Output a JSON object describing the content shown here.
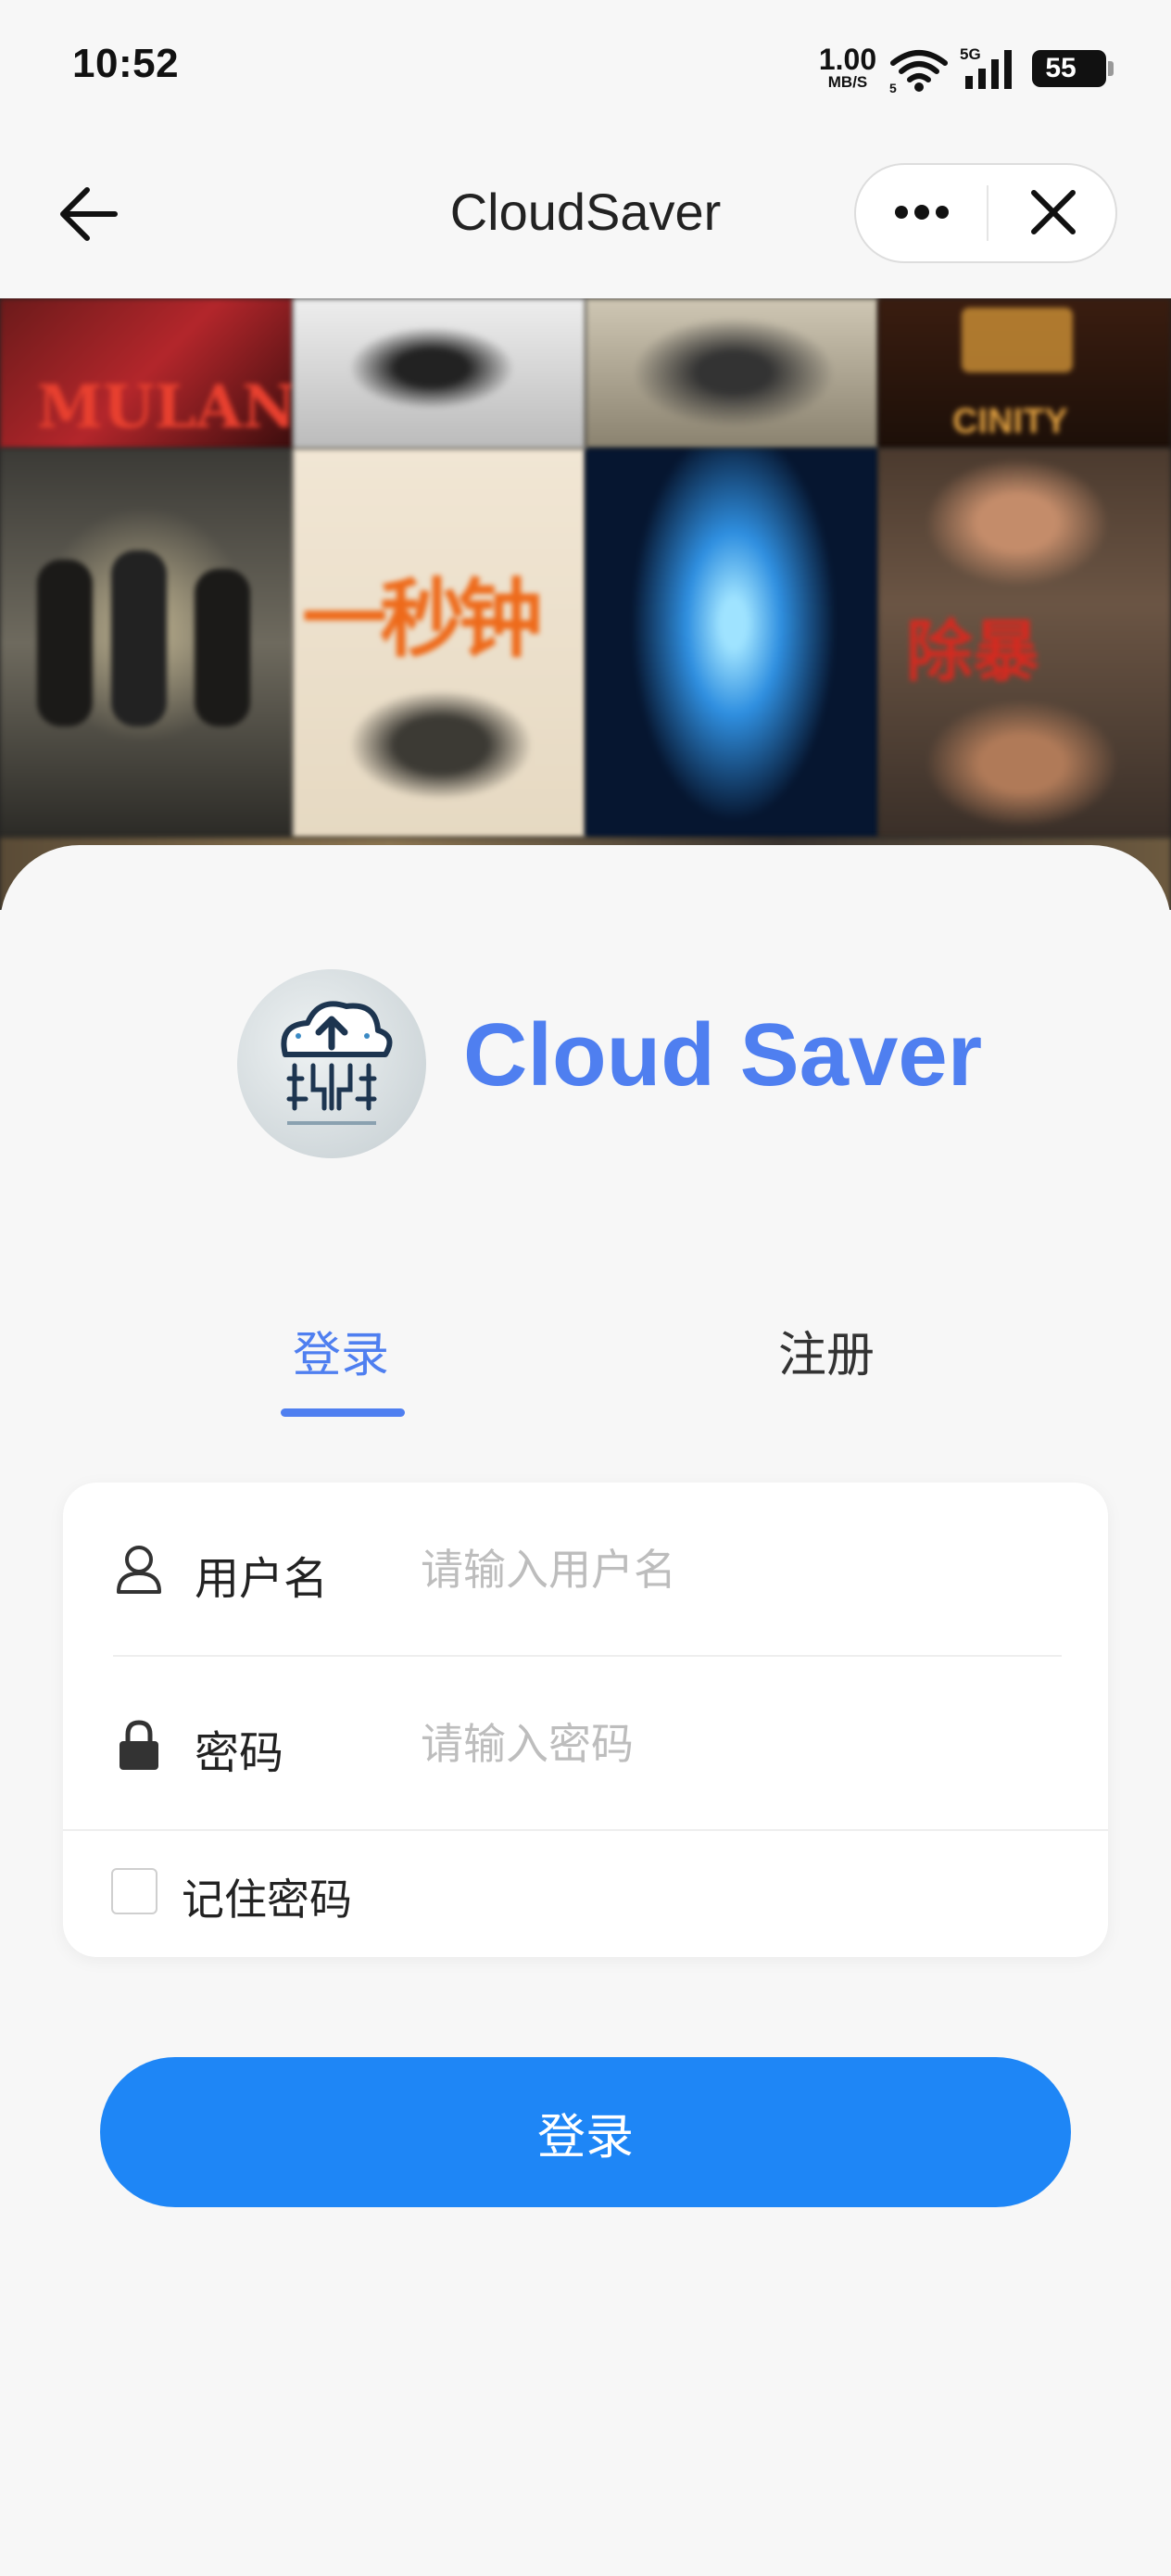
{
  "status_bar": {
    "time": "10:52",
    "net_speed_value": "1.00",
    "net_speed_unit": "MB/S",
    "battery": "55",
    "icons": [
      "wifi-icon",
      "signal-5g-icon",
      "battery-icon"
    ]
  },
  "nav": {
    "title": "CloudSaver",
    "icons": [
      "back-arrow-icon",
      "more-dots-icon",
      "close-icon"
    ]
  },
  "banner": {
    "posters": [
      "MULAN",
      "一秒钟",
      "除暴",
      "CINITY"
    ]
  },
  "brand": {
    "name": "Cloud Saver",
    "logo_icon": "cloud-upload-circuit-icon"
  },
  "tabs": [
    {
      "label": "登录",
      "active": true
    },
    {
      "label": "注册",
      "active": false
    }
  ],
  "form": {
    "username": {
      "label": "用户名",
      "placeholder": "请输入用户名",
      "value": "",
      "icon": "user-icon"
    },
    "password": {
      "label": "密码",
      "placeholder": "请输入密码",
      "value": "",
      "icon": "lock-icon"
    },
    "remember_label": "记住密码",
    "remember_checked": false
  },
  "submit_label": "登录",
  "colors": {
    "accent": "#4f7ff0",
    "button": "#1e86f6",
    "background": "#f7f7f7"
  }
}
